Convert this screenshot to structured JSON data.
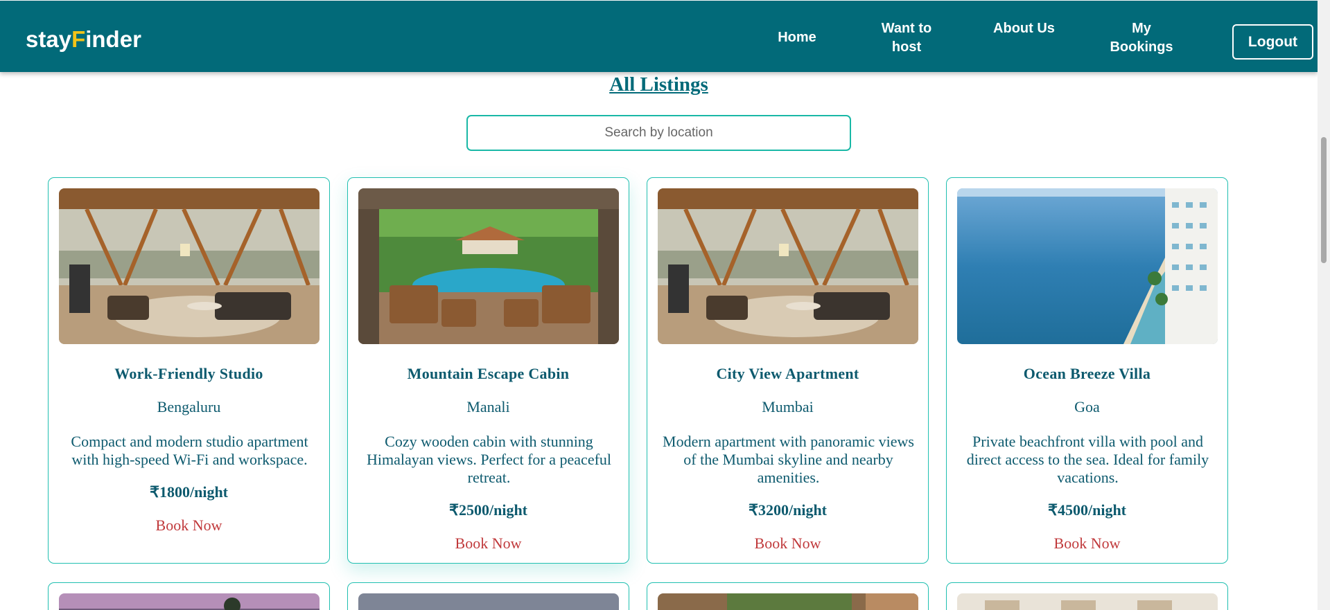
{
  "brand": {
    "prefix": "stay",
    "highlight": "F",
    "suffix": "inder",
    "highlight_color": "#f3c318"
  },
  "nav": {
    "home": "Home",
    "host": "Want to host",
    "about": "About Us",
    "bookings": "My Bookings",
    "logout": "Logout"
  },
  "colors": {
    "primary": "#026a79",
    "accent": "#19b8a6",
    "book": "#c0393b"
  },
  "page": {
    "title": "All Listings",
    "search_placeholder": "Search by location"
  },
  "listings": [
    {
      "title": "Work-Friendly Studio",
      "location": "Bengaluru",
      "description": "Compact and modern studio apartment with high-speed Wi-Fi and workspace.",
      "price": "₹1800/night",
      "book": "Book Now",
      "image": "living-room-forest-view"
    },
    {
      "title": "Mountain Escape Cabin",
      "location": "Manali",
      "description": "Cozy wooden cabin with stunning Himalayan views. Perfect for a peaceful retreat.",
      "price": "₹2500/night",
      "book": "Book Now",
      "image": "pool-patio-chairs"
    },
    {
      "title": "City View Apartment",
      "location": "Mumbai",
      "description": "Modern apartment with panoramic views of the Mumbai skyline and nearby amenities.",
      "price": "₹3200/night",
      "book": "Book Now",
      "image": "living-room-forest-view"
    },
    {
      "title": "Ocean Breeze Villa",
      "location": "Goa",
      "description": "Private beachfront villa with pool and direct access to the sea. Ideal for family vacations.",
      "price": "₹4500/night",
      "book": "Book Now",
      "image": "beach-ocean-hotel"
    }
  ]
}
